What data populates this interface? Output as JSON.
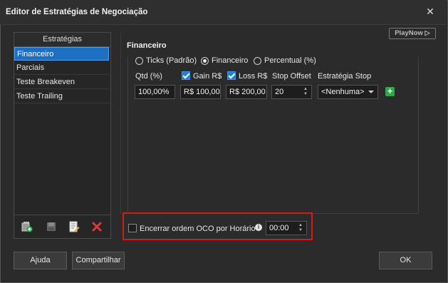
{
  "window": {
    "title": "Editor de Estratégias de Negociação",
    "close_icon": "close-icon"
  },
  "sidebar": {
    "header": "Estratégias",
    "items": [
      {
        "label": "Financeiro",
        "selected": true
      },
      {
        "label": "Parciais",
        "selected": false
      },
      {
        "label": "Teste Breakeven",
        "selected": false
      },
      {
        "label": "Teste Trailing",
        "selected": false
      }
    ],
    "tools": [
      "add-strategy-icon",
      "save-icon",
      "edit-icon",
      "delete-icon"
    ]
  },
  "playnow": {
    "label": "PlayNow ▷"
  },
  "strategy": {
    "section_title": "Financeiro",
    "mode_options": [
      {
        "label": "Ticks (Padrão)",
        "selected": false
      },
      {
        "label": "Financeiro",
        "selected": true
      },
      {
        "label": "Percentual (%)",
        "selected": false
      }
    ],
    "columns": {
      "qtd": "Qtd (%)",
      "gain": "Gain R$",
      "loss": "Loss R$",
      "stop_offset": "Stop Offset",
      "stop_strategy": "Estratégia Stop"
    },
    "gain_checked": true,
    "loss_checked": true,
    "row": {
      "qtd": "100,00%",
      "gain": "R$ 100,00",
      "loss": "R$ 200,00",
      "stop_offset": "20",
      "stop_strategy": "<Nenhuma>"
    }
  },
  "oco": {
    "checked": false,
    "label": "Encerrar ordem OCO por Horário",
    "time": "00:00"
  },
  "footer": {
    "help": "Ajuda",
    "share": "Compartilhar",
    "ok": "OK"
  },
  "colors": {
    "accent": "#1c6fc2",
    "highlight": "#d61a1a",
    "add": "#2fa84a"
  }
}
